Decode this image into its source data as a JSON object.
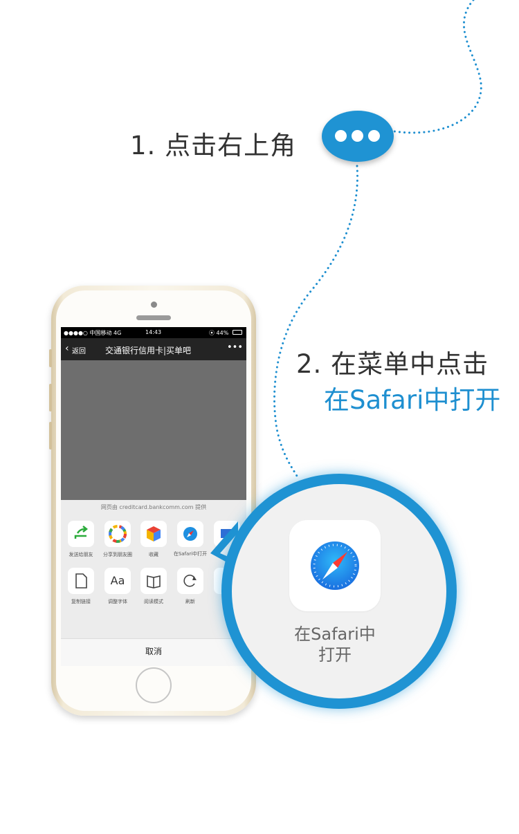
{
  "steps": {
    "step1": "1. 点击右上角",
    "step2": "2. 在菜单中点击",
    "step2_highlight": "在Safari中打开"
  },
  "phone": {
    "status": {
      "carrier": "●●●●○ 中国移动  4G",
      "time": "14:43",
      "battery": "⦿ 44%"
    },
    "nav": {
      "back_label": "返回",
      "title": "交通银行信用卡|买单吧",
      "more": "•••"
    },
    "sheet": {
      "provider": "网页由 creditcard.bankcomm.com 提供",
      "row1": [
        {
          "label": "发送给朋友",
          "icon": "share-arrow-icon"
        },
        {
          "label": "分享到朋友圈",
          "icon": "moments-icon"
        },
        {
          "label": "收藏",
          "icon": "favorite-cube-icon"
        },
        {
          "label": "在Safari中打开",
          "icon": "safari-compass-icon"
        },
        {
          "label": "",
          "icon": "mail-icon"
        }
      ],
      "row2": [
        {
          "label": "复制链接",
          "icon": "copy-link-icon",
          "glyph": "🗋"
        },
        {
          "label": "调整字体",
          "icon": "font-size-icon",
          "glyph": "Aa"
        },
        {
          "label": "阅读模式",
          "icon": "reader-icon",
          "glyph": "📖"
        },
        {
          "label": "刷新",
          "icon": "refresh-icon",
          "glyph": "⟳"
        },
        {
          "label": "",
          "icon": "more-icon",
          "glyph": ""
        }
      ],
      "cancel": "取消"
    }
  },
  "callout": {
    "label_line1": "在Safari中",
    "label_line2": "打开"
  },
  "colors": {
    "accent": "#1e8fd0",
    "text": "#333333",
    "phone_gold": "#d8c9a8"
  }
}
